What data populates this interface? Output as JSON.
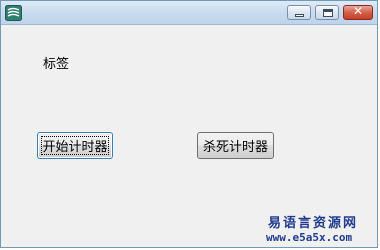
{
  "window": {
    "title": "",
    "icon": "app-logo-icon",
    "controls": {
      "minimize": "minimize-icon",
      "maximize": "maximize-icon",
      "close": "close-icon",
      "close_glyph": "✕"
    }
  },
  "form": {
    "label_text": "标签",
    "start_button": "开始计时器",
    "kill_button": "杀死计时器"
  },
  "watermark": {
    "site_name": "易语言资源网",
    "url": "www.e5a5x.com"
  },
  "colors": {
    "title_gradient_top": "#dfeaf6",
    "close_button": "#c3412a",
    "watermark": "#1f3b8f"
  }
}
